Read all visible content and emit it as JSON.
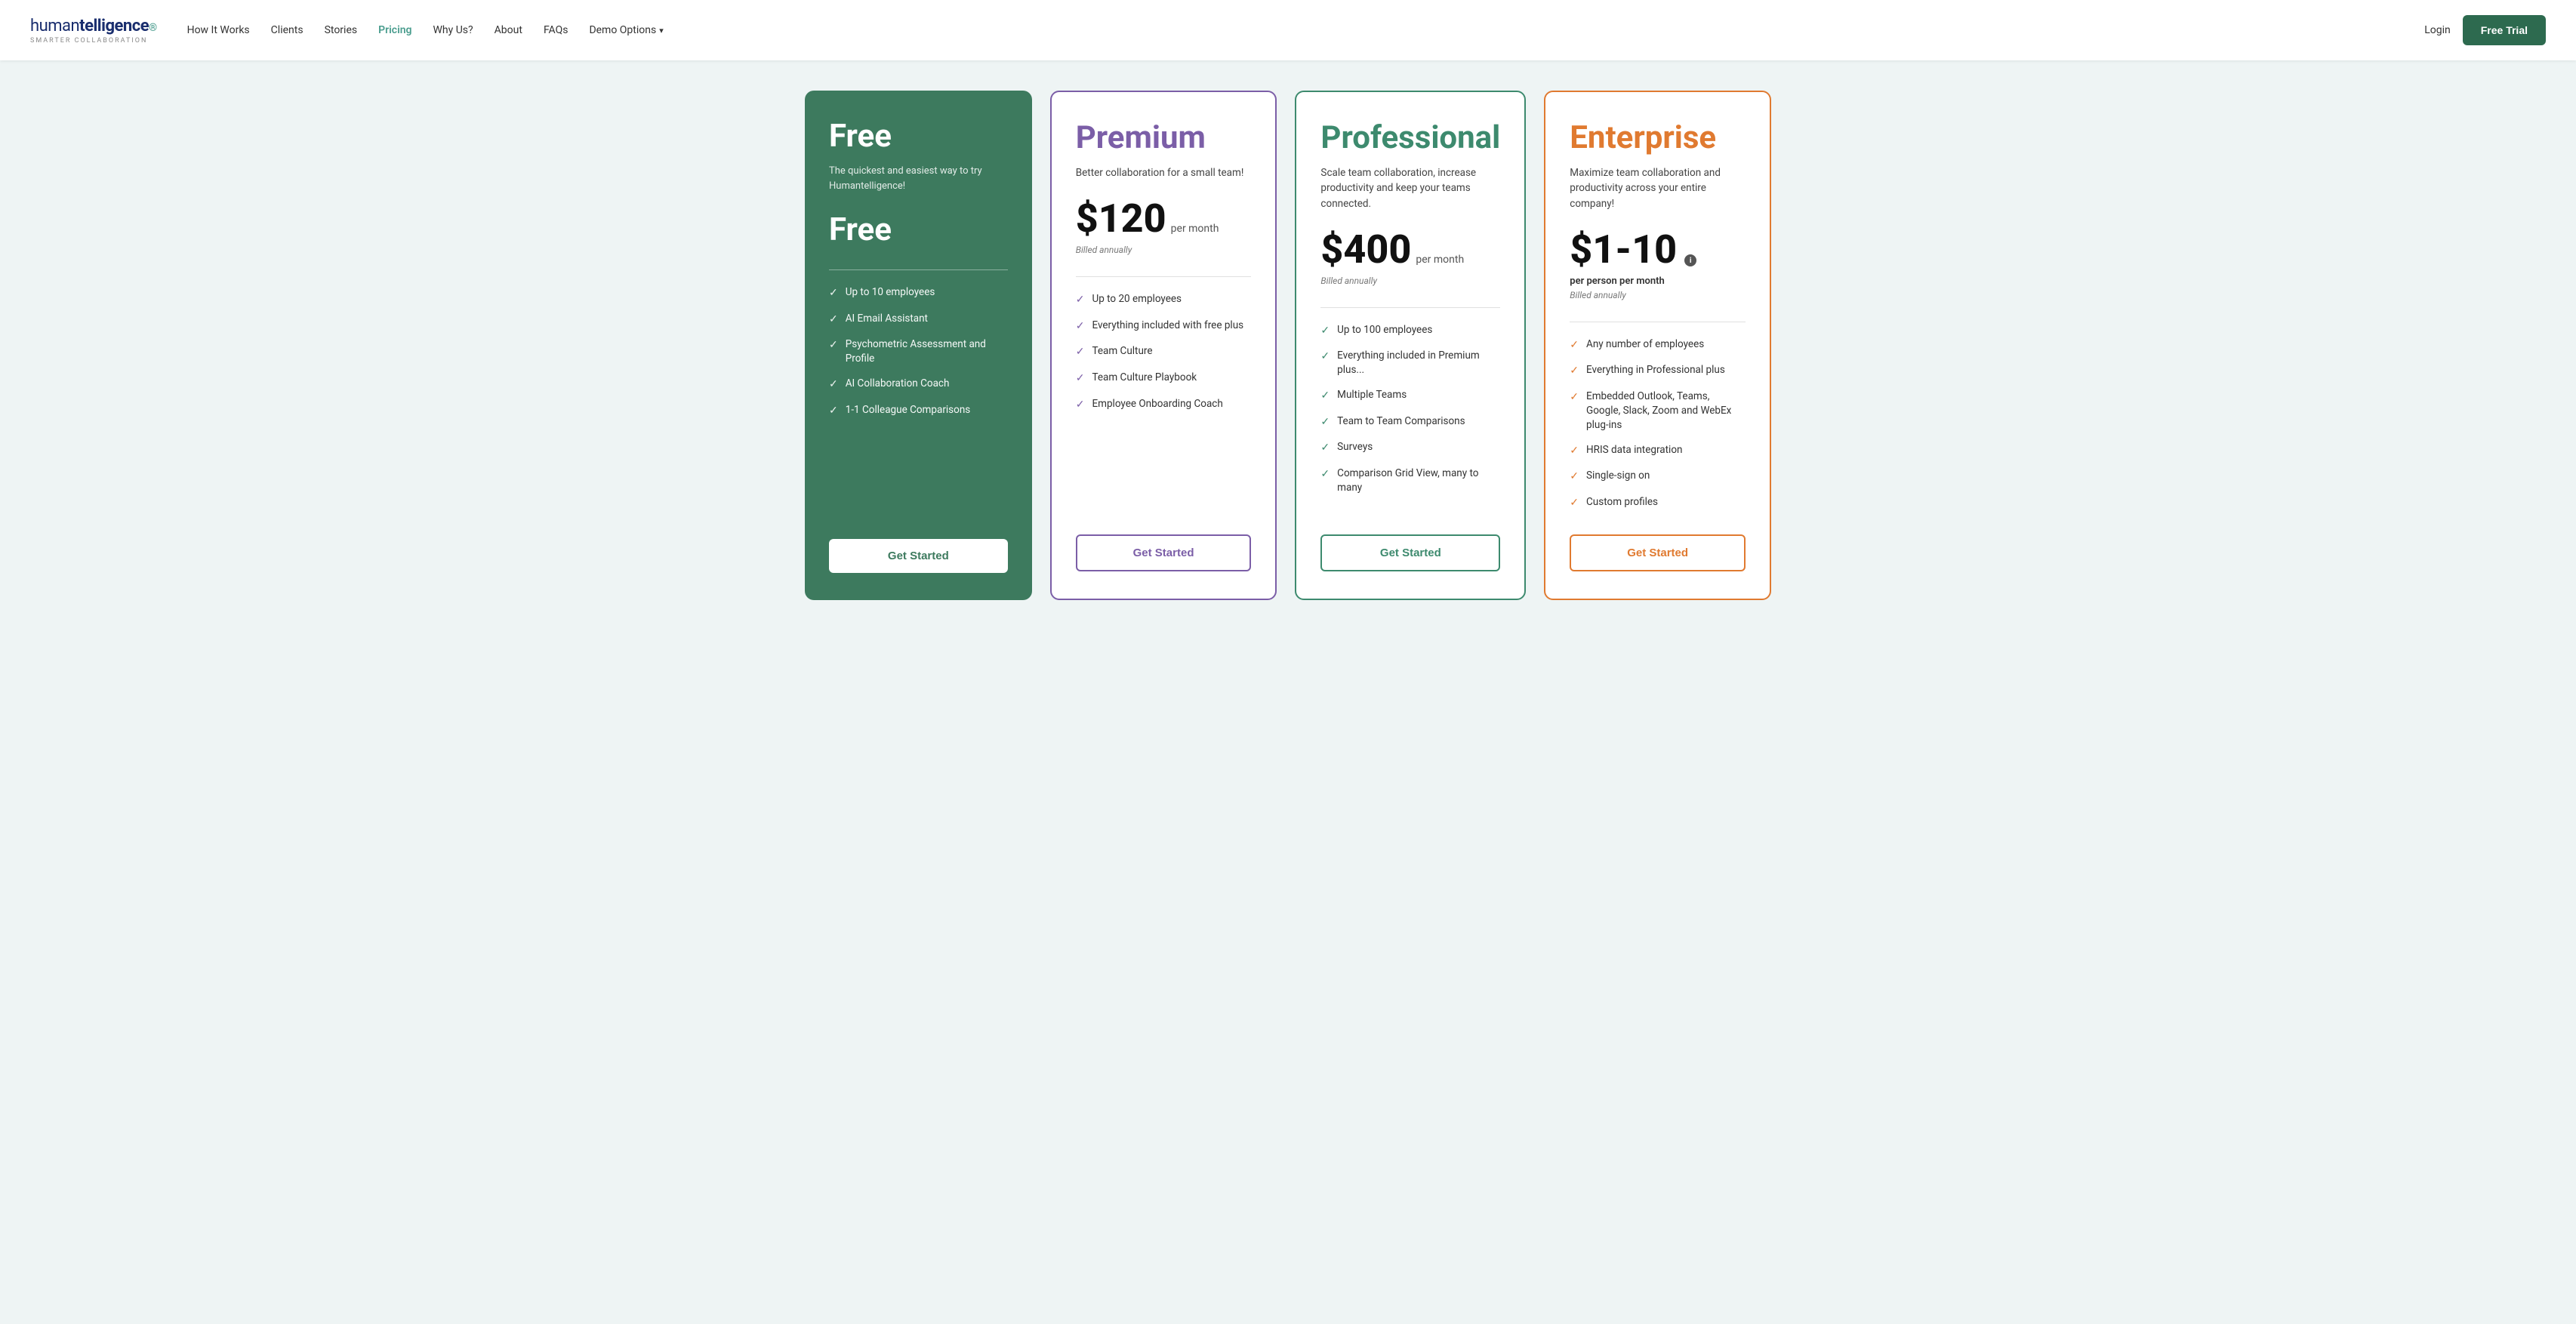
{
  "header": {
    "logo_main": "humantelligence",
    "logo_bold": "telligence",
    "logo_normal": "human",
    "logo_sub": "SMARTER COLLABORATION",
    "nav_items": [
      {
        "label": "How It Works",
        "active": false
      },
      {
        "label": "Clients",
        "active": false
      },
      {
        "label": "Stories",
        "active": false
      },
      {
        "label": "Pricing",
        "active": true
      },
      {
        "label": "Why Us?",
        "active": false
      },
      {
        "label": "About",
        "active": false
      },
      {
        "label": "FAQs",
        "active": false
      }
    ],
    "demo_label": "Demo Options",
    "login_label": "Login",
    "free_trial_label": "Free Trial"
  },
  "plans": [
    {
      "id": "free",
      "title": "Free",
      "desc": "The quickest and easiest way to try Humantelligence!",
      "price_display": "Free",
      "price_amount": null,
      "price_period": null,
      "price_billed": null,
      "price_per_person": null,
      "features": [
        "Up to 10 employees",
        "AI Email Assistant",
        "Psychometric Assessment and Profile",
        "AI Collaboration Coach",
        "1-1 Colleague Comparisons"
      ],
      "cta": "Get Started"
    },
    {
      "id": "premium",
      "title": "Premium",
      "desc": "Better collaboration for a small team!",
      "price_amount": "$120",
      "price_period": "per month",
      "price_billed": "Billed annually",
      "price_per_person": null,
      "features": [
        "Up to 20 employees",
        "Everything included with free plus",
        "Team Culture",
        "Team Culture Playbook",
        "Employee Onboarding Coach"
      ],
      "cta": "Get Started"
    },
    {
      "id": "professional",
      "title": "Professional",
      "desc": "Scale team collaboration, increase productivity and keep your teams connected.",
      "price_amount": "$400",
      "price_period": "per month",
      "price_billed": "Billed annually",
      "price_per_person": null,
      "features": [
        "Up to 100 employees",
        "Everything included in Premium plus...",
        "Multiple Teams",
        "Team to Team Comparisons",
        "Surveys",
        "Comparison Grid View, many to many"
      ],
      "cta": "Get Started"
    },
    {
      "id": "enterprise",
      "title": "Enterprise",
      "desc": "Maximize team collaboration and productivity across your entire company!",
      "price_amount": "$1-10",
      "price_period": "per person per month",
      "price_billed": "Billed annually",
      "price_per_person": "per person per month",
      "features": [
        "Any number of employees",
        "Everything in Professional plus",
        "Embedded Outlook, Teams, Google, Slack, Zoom and WebEx plug-ins",
        "HRIS data integration",
        "Single-sign on",
        "Custom profiles"
      ],
      "cta": "Get Started"
    }
  ]
}
